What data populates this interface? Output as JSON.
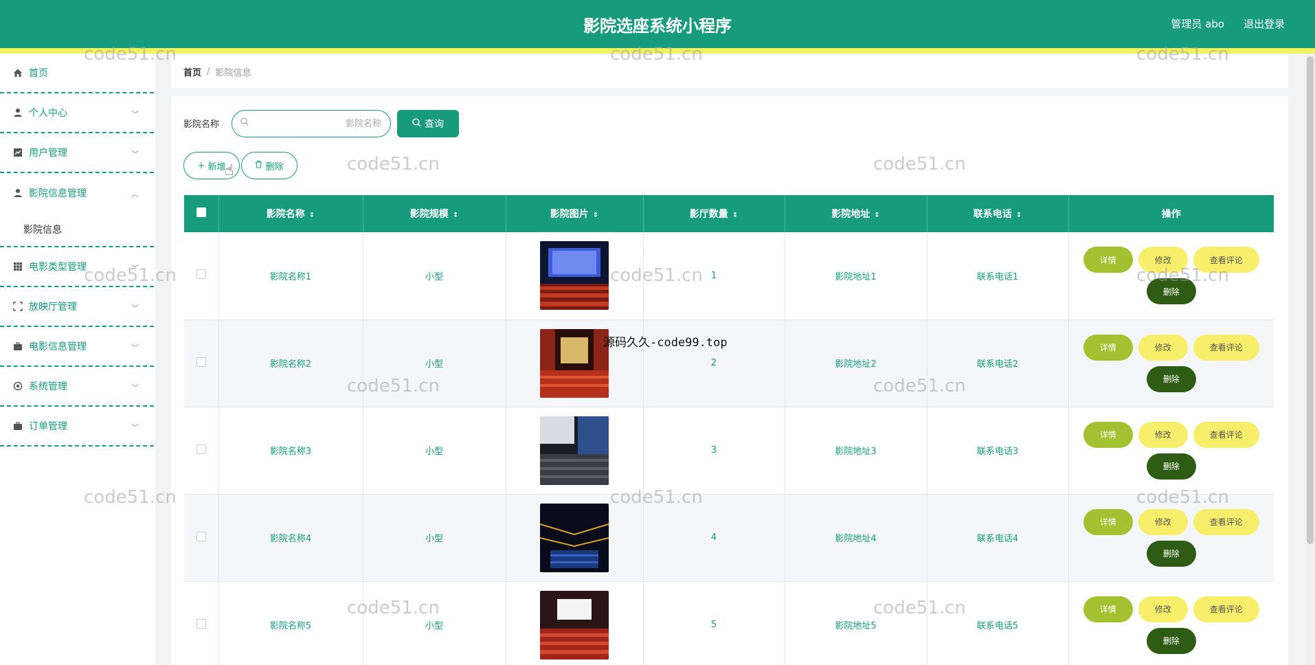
{
  "header": {
    "title": "影院选座系统小程序",
    "user": "管理员 abo",
    "logout": "退出登录"
  },
  "sidebar": {
    "items": [
      {
        "label": "首页",
        "icon": "home-icon"
      },
      {
        "label": "个人中心",
        "icon": "user-icon"
      },
      {
        "label": "用户管理",
        "icon": "chart-icon"
      },
      {
        "label": "影院信息管理",
        "icon": "user-icon"
      },
      {
        "label": "电影类型管理",
        "icon": "grid-icon"
      },
      {
        "label": "放映厅管理",
        "icon": "frame-icon"
      },
      {
        "label": "电影信息管理",
        "icon": "briefcase-icon"
      },
      {
        "label": "系统管理",
        "icon": "settings-icon"
      },
      {
        "label": "订单管理",
        "icon": "briefcase-icon"
      }
    ],
    "submenu_label": "影院信息"
  },
  "breadcrumb": {
    "home": "首页",
    "separator": "/",
    "current": "影院信息"
  },
  "search": {
    "label": "影院名称",
    "placeholder": "影院名称",
    "button": "查询"
  },
  "actions": {
    "add": "新增",
    "delete": "删除"
  },
  "table": {
    "headers": [
      "影院名称",
      "影院规模",
      "影院图片",
      "影厅数量",
      "影院地址",
      "联系电话",
      "操作"
    ],
    "rows": [
      {
        "name": "影院名称1",
        "scale": "小型",
        "count": "1",
        "address": "影院地址1",
        "phone": "联系电话1"
      },
      {
        "name": "影院名称2",
        "scale": "小型",
        "count": "2",
        "address": "影院地址2",
        "phone": "联系电话2"
      },
      {
        "name": "影院名称3",
        "scale": "小型",
        "count": "3",
        "address": "影院地址3",
        "phone": "联系电话3"
      },
      {
        "name": "影院名称4",
        "scale": "小型",
        "count": "4",
        "address": "影院地址4",
        "phone": "联系电话4"
      },
      {
        "name": "影院名称5",
        "scale": "小型",
        "count": "5",
        "address": "影院地址5",
        "phone": "联系电话5"
      }
    ],
    "ops": {
      "detail": "详情",
      "edit": "修改",
      "review": "查看评论",
      "delete": "删除"
    }
  },
  "watermark": {
    "text": "code51.cn",
    "text2": "源码久久-code99.top"
  },
  "colors": {
    "primary": "#169c7c",
    "accent_line": "#f0f45e",
    "detail_btn": "#a4c130",
    "edit_btn": "#f7ef6a",
    "delete_btn": "#2f5c14"
  }
}
